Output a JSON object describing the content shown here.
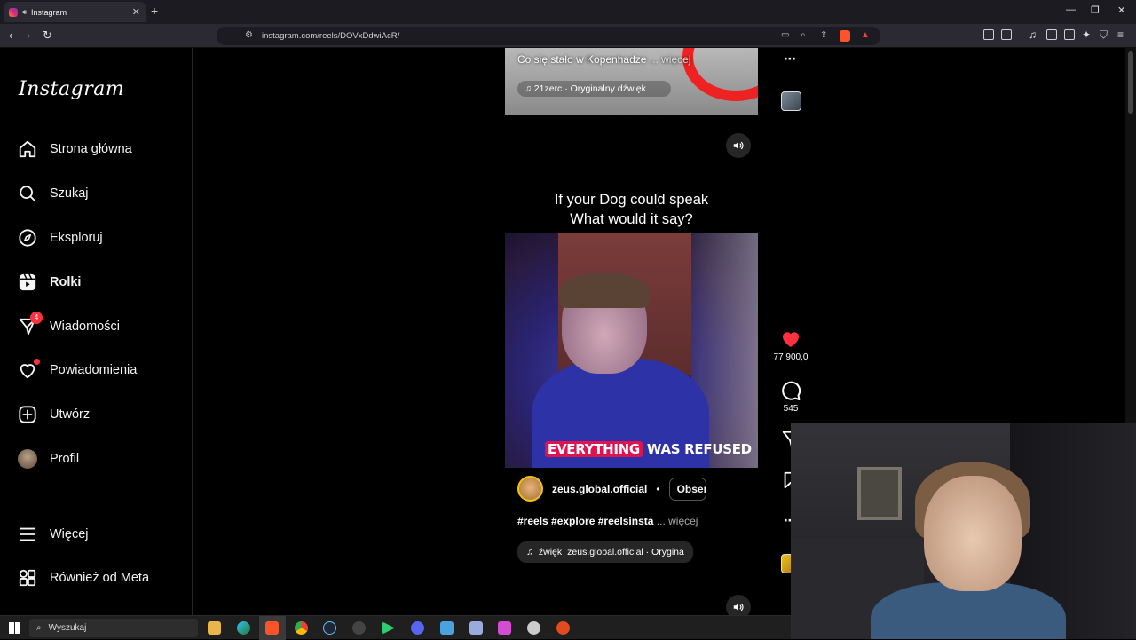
{
  "browser": {
    "tab_title": "Instagram",
    "tab_close": "✕",
    "new_tab": "+",
    "url": "instagram.com/reels/DOVxDdwiAcR/",
    "window_controls": [
      "—",
      "❐",
      "✕"
    ]
  },
  "sidebar": {
    "logo": "Instagram",
    "items": [
      {
        "label": "Strona główna",
        "icon": "home-icon"
      },
      {
        "label": "Szukaj",
        "icon": "search-icon"
      },
      {
        "label": "Eksploruj",
        "icon": "compass-icon"
      },
      {
        "label": "Rolki",
        "icon": "reels-icon",
        "active": true
      },
      {
        "label": "Wiadomości",
        "icon": "messenger-icon",
        "badge": "4"
      },
      {
        "label": "Powiadomienia",
        "icon": "heart-icon"
      },
      {
        "label": "Utwórz",
        "icon": "plus-square-icon"
      },
      {
        "label": "Profil",
        "icon": "avatar-icon"
      }
    ],
    "bottom_items": [
      {
        "label": "Więcej",
        "icon": "menu-icon"
      },
      {
        "label": "Również od Meta",
        "icon": "meta-apps-icon"
      }
    ]
  },
  "reel_prev": {
    "caption": "Co się stało w Kopenhadze",
    "caption_more": "... więcej",
    "audio": "21zerc · Oryginalny dźwięk"
  },
  "reel": {
    "headline_1": "If your Dog could speak",
    "headline_2": "What would it say?",
    "subtitle_hl": "EVERYTHING",
    "subtitle_rest": "WAS REFUSED",
    "author": "zeus.global.official",
    "separator": "•",
    "follow": "Obser",
    "hashtags": "#reels #explore #reelsinsta",
    "more": "... więcej",
    "audio_prefix": "źwięk",
    "audio": "zeus.global.official · Orygina",
    "likes": "77 900,0",
    "comments": "545",
    "more_dots": "⋯"
  },
  "taskbar": {
    "search_placeholder": "Wyszukaj"
  },
  "colors": {
    "accent_red": "#ff3040",
    "subtitle_highlight": "#e0124f"
  }
}
